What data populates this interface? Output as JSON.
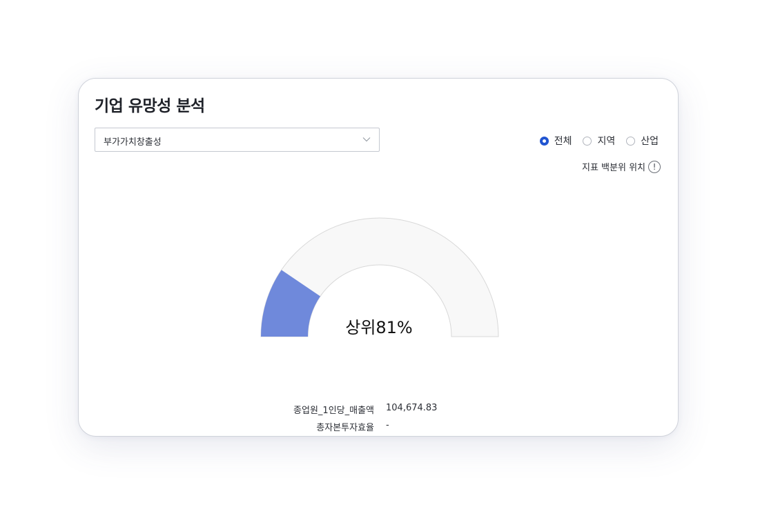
{
  "card": {
    "title": "기업 유망성 분석"
  },
  "indicator_select": {
    "selected": "부가가치창출성",
    "icon": "chevron-down-icon"
  },
  "scope_filter": {
    "options": [
      {
        "label": "전체",
        "checked": true
      },
      {
        "label": "지역",
        "checked": false
      },
      {
        "label": "산업",
        "checked": false
      }
    ]
  },
  "percentile_info": {
    "label": "지표 백분위 위치",
    "icon_glyph": "!",
    "icon": "info-icon"
  },
  "gauge": {
    "label": "상위81%",
    "fill_fraction": 0.19,
    "fill_color": "#6f89db",
    "track_color": "#f8f8f8",
    "border_color": "#d8d8d8"
  },
  "metrics": [
    {
      "label": "종업원_1인당_매출액",
      "value": "104,674.83"
    },
    {
      "label": "총자본투자효율",
      "value": "-"
    }
  ],
  "colors": {
    "accent": "#2155d1",
    "card_border": "#cfd2da",
    "title": "#1f2229"
  }
}
